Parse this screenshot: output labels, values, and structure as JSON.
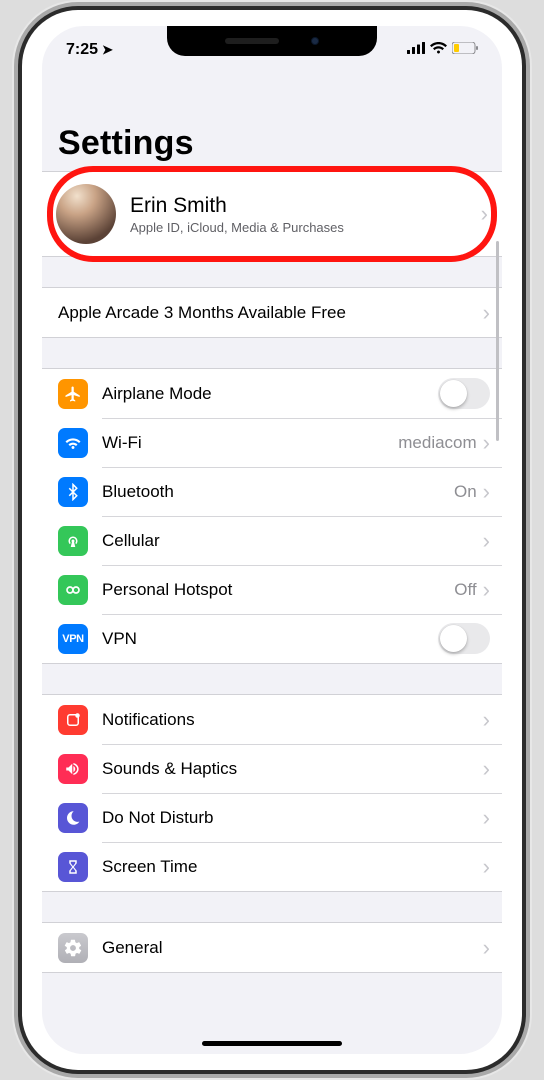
{
  "status": {
    "time": "7:25"
  },
  "title": "Settings",
  "profile": {
    "name": "Erin Smith",
    "sub": "Apple ID, iCloud, Media & Purchases"
  },
  "promo": {
    "label": "Apple Arcade 3 Months Available Free"
  },
  "network": {
    "airplane": {
      "label": "Airplane Mode"
    },
    "wifi": {
      "label": "Wi-Fi",
      "value": "mediacom"
    },
    "bluetooth": {
      "label": "Bluetooth",
      "value": "On"
    },
    "cellular": {
      "label": "Cellular"
    },
    "hotspot": {
      "label": "Personal Hotspot",
      "value": "Off"
    },
    "vpn": {
      "label": "VPN"
    }
  },
  "noti": {
    "notifications": {
      "label": "Notifications"
    },
    "sounds": {
      "label": "Sounds & Haptics"
    },
    "dnd": {
      "label": "Do Not Disturb"
    },
    "screentime": {
      "label": "Screen Time"
    }
  },
  "general": {
    "label": "General"
  }
}
